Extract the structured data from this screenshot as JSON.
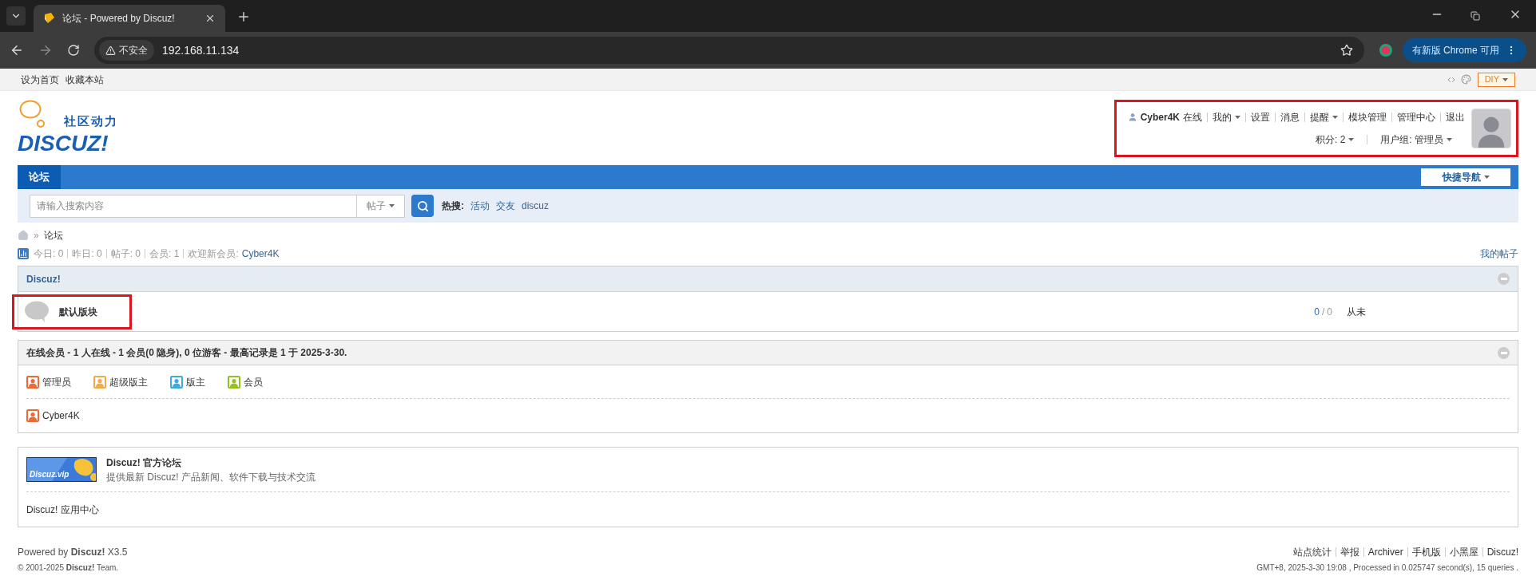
{
  "browser": {
    "tab": {
      "title": "论坛 - Powered by Discuz!"
    },
    "address": {
      "security_label": "不安全",
      "url": "192.168.11.134"
    },
    "update_button": "有新版 Chrome 可用"
  },
  "topbar": {
    "links": [
      "设为首页",
      "收藏本站"
    ],
    "diy": "DIY"
  },
  "logo": {
    "tagline": "社区动力",
    "wordmark": "DISCUZ!"
  },
  "user_panel": {
    "highlighted": true,
    "username": "Cyber4K",
    "status": "在线",
    "links": [
      {
        "label": "我的",
        "dropdown": true
      },
      {
        "label": "设置",
        "dropdown": false
      },
      {
        "label": "消息",
        "dropdown": false
      },
      {
        "label": "提醒",
        "dropdown": true
      },
      {
        "label": "模块管理",
        "dropdown": false
      },
      {
        "label": "管理中心",
        "dropdown": false
      },
      {
        "label": "退出",
        "dropdown": false
      }
    ],
    "credits": "积分: 2",
    "group": "用户组: 管理员"
  },
  "nav": {
    "items": [
      {
        "label": "论坛",
        "selected": true
      }
    ],
    "quick_nav": "快捷导航"
  },
  "search": {
    "placeholder": "请输入搜索内容",
    "type": "帖子",
    "hot_label": "热搜:",
    "hot": [
      "活动",
      "交友",
      "discuz"
    ]
  },
  "breadcrumb": {
    "separator": "»",
    "items": [
      "论坛"
    ]
  },
  "stats": {
    "items": [
      "今日: 0",
      "昨日: 0",
      "帖子: 0",
      "会员: 1"
    ],
    "welcome": "欢迎新会员:",
    "new_member": "Cyber4K",
    "my_posts": "我的帖子"
  },
  "category": {
    "title": "Discuz!",
    "expanded": true,
    "forums": [
      {
        "name": "默认版块",
        "highlighted": true,
        "threads": "0",
        "count_separator": "/",
        "posts": "0",
        "last_post": "从未"
      }
    ]
  },
  "online": {
    "title": "在线会员 - 1 人在线 - 1 会员(0 隐身), 0 位游客 - 最高记录是 1 于 2025-3-30.",
    "expanded": true,
    "legend": [
      {
        "label": "管理员",
        "color": "#ee6a34"
      },
      {
        "label": "超级版主",
        "color": "#f2a94a"
      },
      {
        "label": "版主",
        "color": "#3fa9e0"
      },
      {
        "label": "会员",
        "color": "#94c11f"
      }
    ],
    "members": [
      {
        "name": "Cyber4K",
        "color": "#ee6a34"
      }
    ]
  },
  "links": {
    "featured": {
      "banner": "Discuz.vip",
      "title": "Discuz! 官方论坛",
      "description": "提供最新 Discuz! 产品新闻、软件下载与技术交流"
    },
    "text_links": [
      "Discuz! 应用中心"
    ]
  },
  "footer": {
    "powered": "Powered by **Discuz!** X3.5",
    "copyright": "© 2001-2025 **Discuz!** Team.",
    "links": [
      "站点统计",
      "举报",
      "Archiver",
      "手机版",
      "小黑屋",
      "Discuz!"
    ],
    "processed": "GMT+8, 2025-3-30 19:08 , Processed in 0.025747 second(s), 15 queries ."
  }
}
